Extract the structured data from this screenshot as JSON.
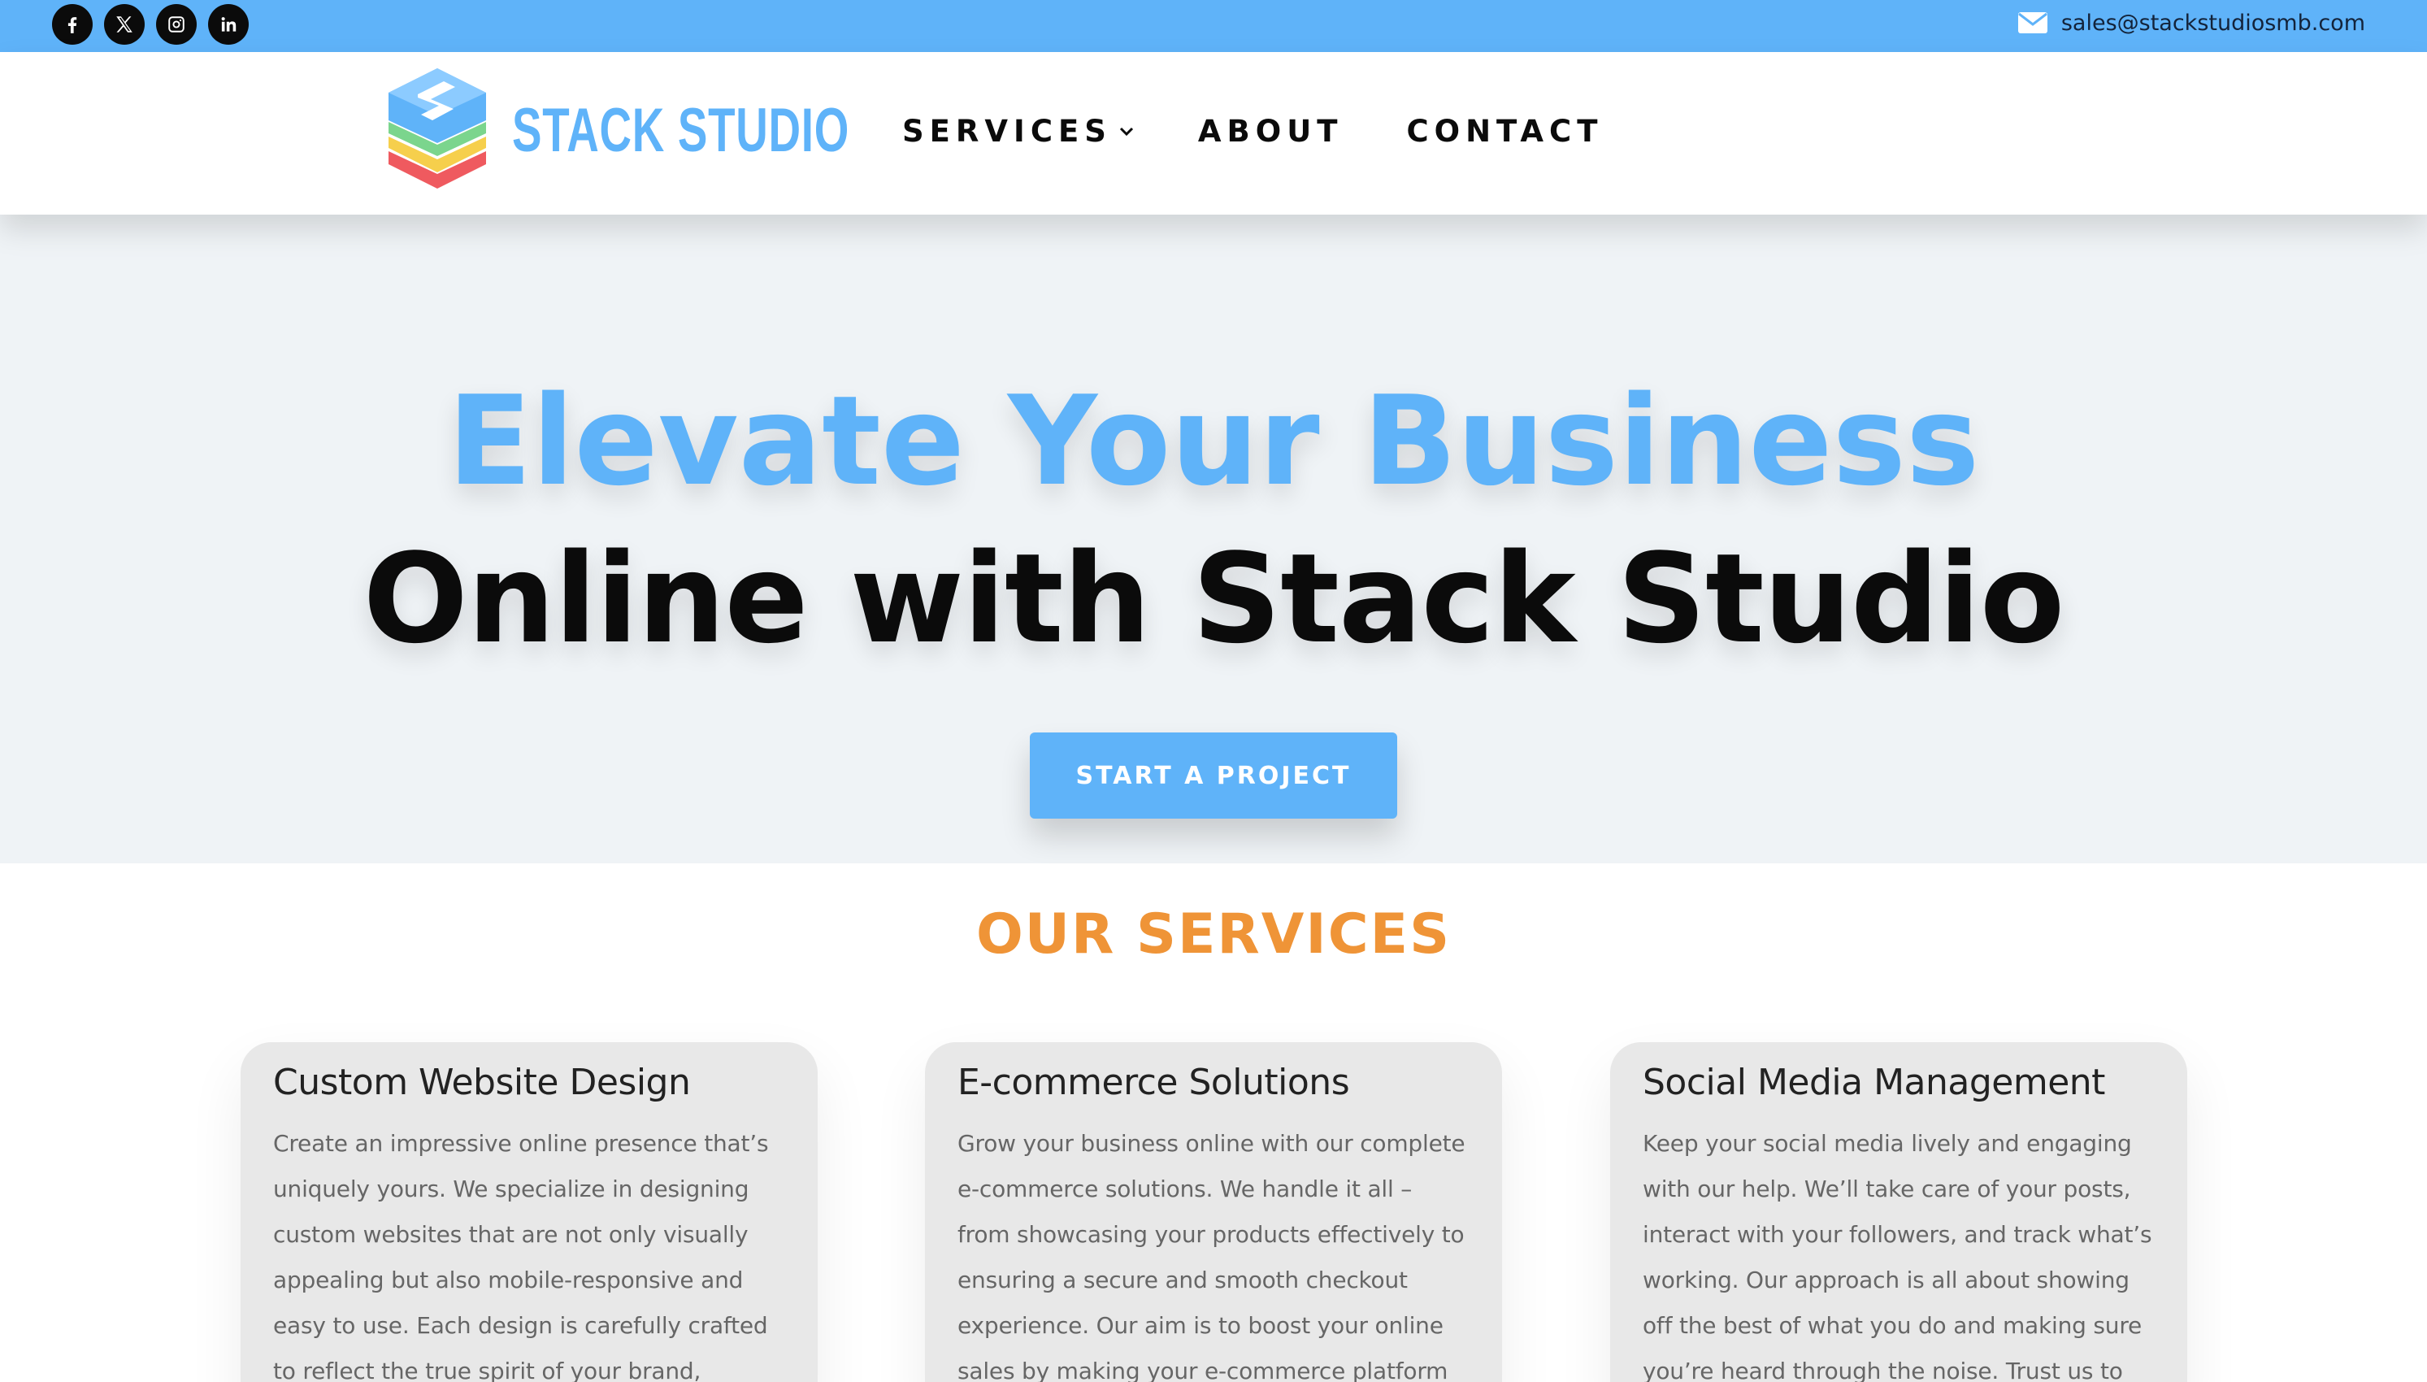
{
  "topbar": {
    "social": [
      {
        "name": "facebook",
        "icon": "facebook-icon"
      },
      {
        "name": "x",
        "icon": "x-icon"
      },
      {
        "name": "instagram",
        "icon": "instagram-icon"
      },
      {
        "name": "linkedin",
        "icon": "linkedin-icon"
      }
    ],
    "email": "sales@stackstudiosmb.com",
    "email_icon": "envelope-icon"
  },
  "header": {
    "logo_text": "STACK STUDIO",
    "nav": {
      "services": "SERVICES",
      "about": "ABOUT",
      "contact": "CONTACT"
    }
  },
  "hero": {
    "line1": "Elevate Your Business",
    "line2": "Online with Stack Studio",
    "cta": "START A PROJECT"
  },
  "services": {
    "title": "OUR SERVICES",
    "cards": [
      {
        "title": "Custom Website Design",
        "text": "Create an impressive online presence that’s uniquely yours. We specialize in designing custom websites that are not only visually appealing but also mobile-responsive and easy to use. Each design is carefully crafted to reflect the true spirit of your brand, ensuring that your"
      },
      {
        "title": "E-commerce Solutions",
        "text": "Grow your business online with our complete e-commerce solutions. We handle it all – from showcasing your products effectively to ensuring a secure and smooth checkout experience. Our aim is to boost your online sales by making your e-commerce platform"
      },
      {
        "title": "Social Media Management",
        "text": "Keep your social media lively and engaging with our help. We’ll take care of your posts, interact with your followers, and track what’s working. Our approach is all about showing off the best of what you do and making sure you’re heard through the noise. Trust us to keep your feeds"
      }
    ]
  },
  "colors": {
    "accent_blue": "#5fb3f9",
    "accent_orange": "#ef9437",
    "hero_bg": "#eff3f6",
    "card_bg": "#e8e8e8"
  }
}
